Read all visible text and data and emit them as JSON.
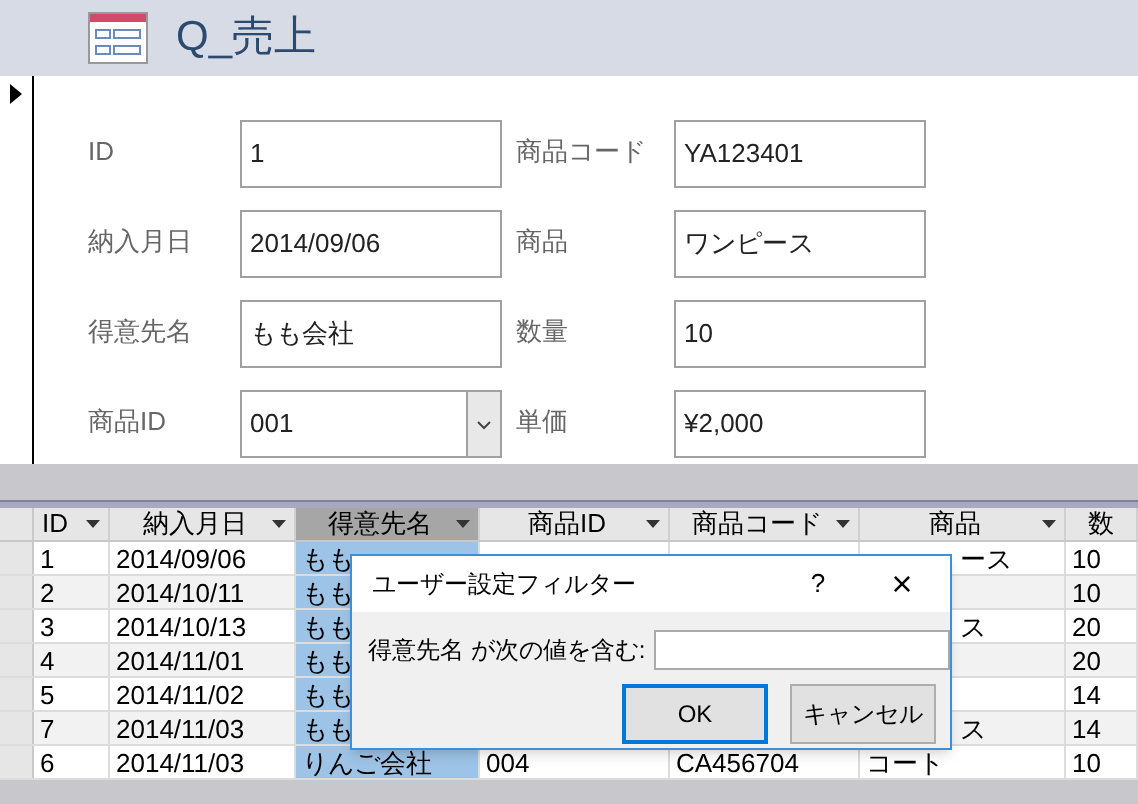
{
  "form": {
    "title": "Q_売上",
    "fields": [
      {
        "label": "ID",
        "value": "1",
        "kind": "text"
      },
      {
        "label": "商品コード",
        "value": "YA123401",
        "kind": "text"
      },
      {
        "label": "納入月日",
        "value": "2014/09/06",
        "kind": "text"
      },
      {
        "label": "商品",
        "value": "ワンピース",
        "kind": "text"
      },
      {
        "label": "得意先名",
        "value": "もも会社",
        "kind": "text"
      },
      {
        "label": "数量",
        "value": "10",
        "kind": "text"
      },
      {
        "label": "商品ID",
        "value": "001",
        "kind": "combo"
      },
      {
        "label": "単価",
        "value": "¥2,000",
        "kind": "text"
      }
    ]
  },
  "datasheet": {
    "columns": [
      {
        "label": "ID",
        "selected": false
      },
      {
        "label": "納入月日",
        "selected": false
      },
      {
        "label": "得意先名",
        "selected": true
      },
      {
        "label": "商品ID",
        "selected": false
      },
      {
        "label": "商品コード",
        "selected": false
      },
      {
        "label": "商品",
        "selected": false
      },
      {
        "label": "数",
        "selected": false
      }
    ],
    "rows": [
      {
        "covered": true,
        "cells": [
          "1",
          "2014/09/06",
          "もも",
          "",
          "",
          "ース",
          "10"
        ]
      },
      {
        "covered": true,
        "cells": [
          "2",
          "2014/10/11",
          "もも",
          "",
          "",
          "",
          "10"
        ]
      },
      {
        "covered": true,
        "cells": [
          "3",
          "2014/10/13",
          "もも",
          "",
          "",
          "ス",
          "20"
        ]
      },
      {
        "covered": true,
        "cells": [
          "4",
          "2014/11/01",
          "もも",
          "",
          "",
          "",
          "20"
        ]
      },
      {
        "covered": true,
        "cells": [
          "5",
          "2014/11/02",
          "もも",
          "",
          "",
          "",
          "14"
        ]
      },
      {
        "covered": true,
        "cells": [
          "7",
          "2014/11/03",
          "もも",
          "",
          "",
          "ス",
          "14"
        ]
      },
      {
        "covered": false,
        "cells": [
          "6",
          "2014/11/03",
          "りんご会社",
          "004",
          "CA456704",
          "コート",
          "10"
        ]
      }
    ]
  },
  "dialog": {
    "title": "ユーザー設定フィルター",
    "help": "?",
    "close": "×",
    "prompt": "得意先名 が次の値を含む:",
    "buttons": [
      {
        "label": "OK",
        "selected": true
      },
      {
        "label": "キャンセル",
        "selected": false
      }
    ]
  }
}
